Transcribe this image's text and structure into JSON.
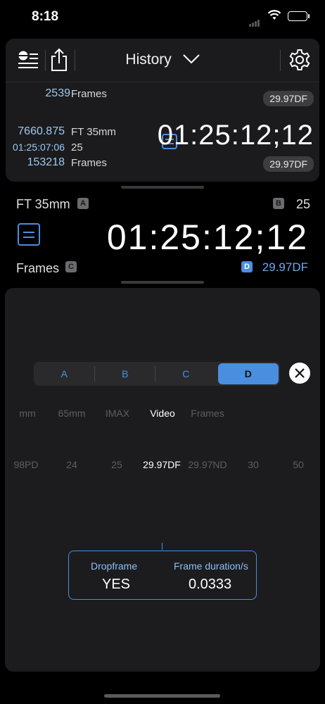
{
  "status": {
    "time": "8:18"
  },
  "toolbar": {
    "title": "History"
  },
  "history": {
    "row1": {
      "num_top": "2539",
      "lbl_top": "Frames",
      "rate": "29.97DF"
    },
    "row2": {
      "num1": "7660.875",
      "lbl1": "FT 35mm",
      "num2": "01:25:07:06",
      "lbl2": "25",
      "num3": "153218",
      "lbl3": "Frames",
      "timecode": "01:25:12;12",
      "rate": "29.97DF"
    }
  },
  "calc": {
    "unit_a": "FT 35mm",
    "key_a": "A",
    "key_b": "B",
    "value_b": "25",
    "timecode": "01:25:12;12",
    "unit_c": "Frames",
    "key_c": "C",
    "key_d": "D",
    "rate_d": "29.97DF"
  },
  "segments": [
    "A",
    "B",
    "C",
    "D"
  ],
  "selected_segment": "D",
  "format_picker": [
    "mm",
    "65mm",
    "IMAX",
    "Video",
    "Frames"
  ],
  "format_selected": "Video",
  "rate_picker": [
    "98PD",
    "24",
    "25",
    "29.97DF",
    "29.97ND",
    "30",
    "50"
  ],
  "rate_selected": "29.97DF",
  "info": {
    "dropframe_label": "Dropframe",
    "dropframe_value": "YES",
    "duration_label": "Frame duration/s",
    "duration_value": "0.0333"
  },
  "colors": {
    "accent": "#4a8ee0",
    "history_number": "#9ec9f2",
    "background": "#000000",
    "panel": "#1c1c1e"
  }
}
